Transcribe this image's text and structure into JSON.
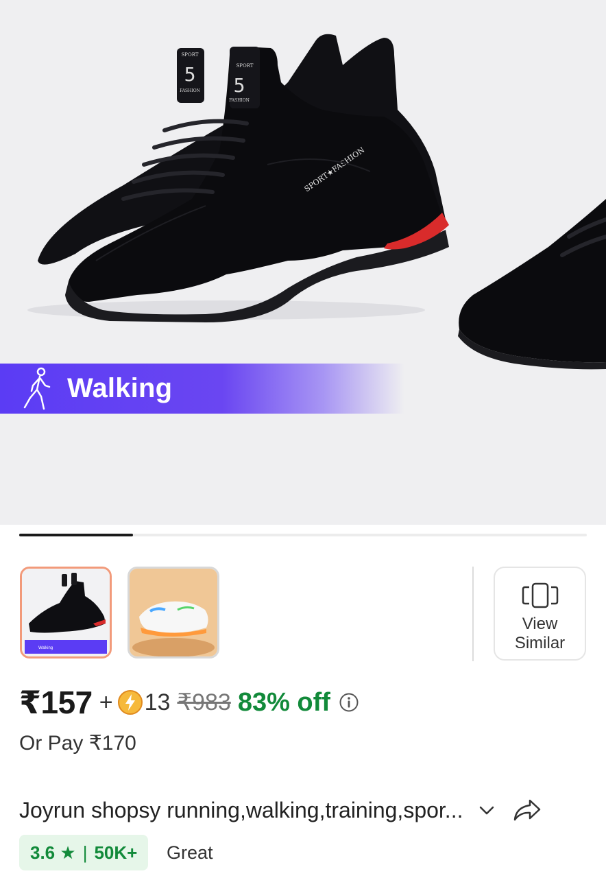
{
  "hero": {
    "banner_label": "Walking",
    "shoe_text": {
      "tongue_top": "SPORT",
      "tongue_number": "5",
      "tongue_bottom": "FASHION",
      "side": "SPORT★FASHION"
    }
  },
  "gallery": {
    "current_slide": 1,
    "total_slides": 5,
    "thumbnails": [
      {
        "label": "Walking",
        "selected": true
      },
      {
        "label": "",
        "selected": false
      }
    ],
    "view_similar_line1": "View",
    "view_similar_line2": "Similar"
  },
  "pricing": {
    "price": "₹157",
    "plus": "+",
    "coins": "13",
    "mrp": "₹983",
    "discount": "83% off",
    "or_pay": "Or Pay ₹170"
  },
  "product": {
    "title": "Joyrun shopsy running,walking,training,spor..."
  },
  "rating": {
    "score": "3.6 ★",
    "separator": "|",
    "count": "50K+",
    "label": "Great"
  },
  "colors": {
    "banner": "#5b3cf4",
    "discount": "#128a3a",
    "rating_bg": "#e6f6e9",
    "selected_thumb_border": "#f29a7a"
  },
  "icons": [
    "walker-icon",
    "coin-icon",
    "info-icon",
    "view-similar-icon",
    "chevron-down-icon",
    "share-icon"
  ]
}
